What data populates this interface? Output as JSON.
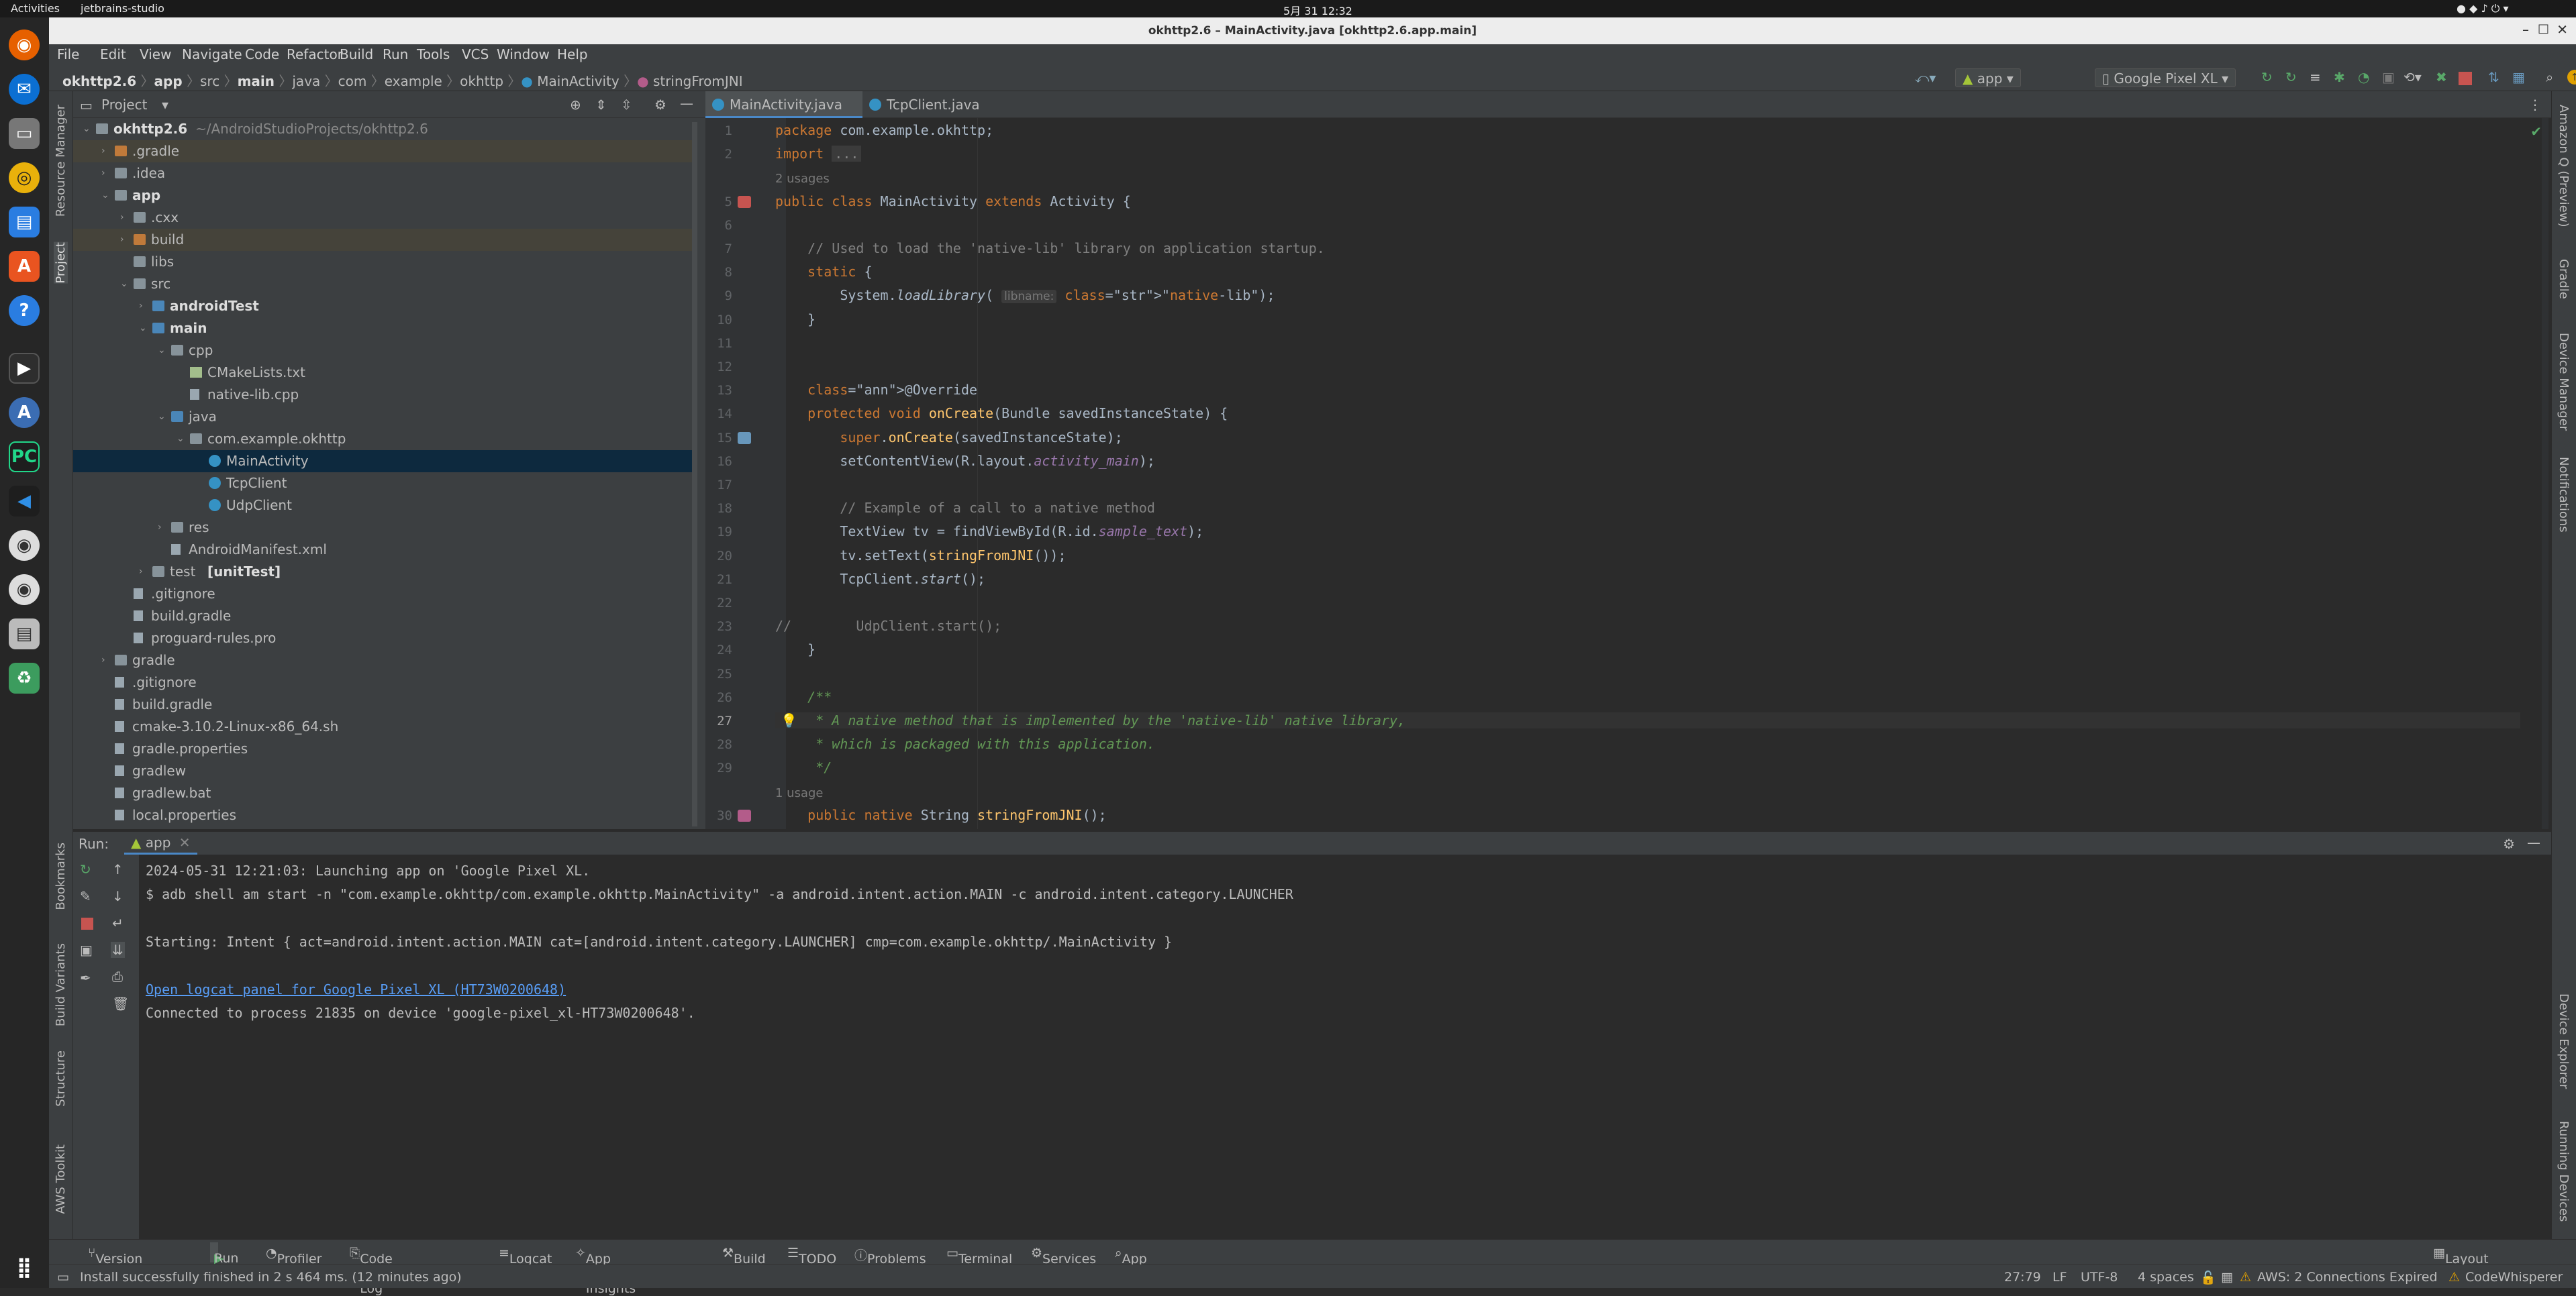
{
  "topbar": {
    "activities": "Activities",
    "app_name": "jetbrains-studio",
    "datetime": "5月 31  12:32"
  },
  "window": {
    "title": "okhttp2.6 – MainActivity.java [okhttp2.6.app.main]"
  },
  "menu": [
    "File",
    "Edit",
    "View",
    "Navigate",
    "Code",
    "Refactor",
    "Build",
    "Run",
    "Tools",
    "VCS",
    "Window",
    "Help"
  ],
  "breadcrumb": [
    "okhttp2.6",
    "app",
    "src",
    "main",
    "java",
    "com",
    "example",
    "okhttp",
    "MainActivity",
    "stringFromJNI"
  ],
  "toolbar": {
    "run_config": "app",
    "device": "Google Pixel XL"
  },
  "left_strip": [
    "Resource Manager",
    "Project",
    "Bookmarks",
    "Build Variants",
    "Structure",
    "AWS Toolkit"
  ],
  "right_strip": [
    "Amazon Q (Preview)",
    "Gradle",
    "Device Manager",
    "Notifications",
    "Device Explorer",
    "Running Devices"
  ],
  "project": {
    "header": "Project",
    "tree": [
      {
        "label": "okhttp2.6",
        "path": "~/AndroidStudioProjects/okhttp2.6",
        "bold": true
      },
      {
        "label": ".gradle"
      },
      {
        "label": ".idea"
      },
      {
        "label": "app",
        "bold": true
      },
      {
        "label": ".cxx"
      },
      {
        "label": "build"
      },
      {
        "label": "libs"
      },
      {
        "label": "src"
      },
      {
        "label": "androidTest",
        "bold": true
      },
      {
        "label": "main",
        "bold": true
      },
      {
        "label": "cpp"
      },
      {
        "label": "CMakeLists.txt"
      },
      {
        "label": "native-lib.cpp"
      },
      {
        "label": "java"
      },
      {
        "label": "com.example.okhttp"
      },
      {
        "label": "MainActivity"
      },
      {
        "label": "TcpClient"
      },
      {
        "label": "UdpClient"
      },
      {
        "label": "res"
      },
      {
        "label": "AndroidManifest.xml"
      },
      {
        "label": "test",
        "suffix": "[unitTest]"
      },
      {
        "label": ".gitignore"
      },
      {
        "label": "build.gradle"
      },
      {
        "label": "proguard-rules.pro"
      },
      {
        "label": "gradle"
      },
      {
        "label": ".gitignore"
      },
      {
        "label": "build.gradle"
      },
      {
        "label": "cmake-3.10.2-Linux-x86_64.sh"
      },
      {
        "label": "gradle.properties"
      },
      {
        "label": "gradlew"
      },
      {
        "label": "gradlew.bat"
      },
      {
        "label": "local.properties"
      }
    ]
  },
  "editor": {
    "tabs": [
      "MainActivity.java",
      "TcpClient.java"
    ],
    "lines": [
      {
        "n": "1",
        "text": "package com.example.okhttp;"
      },
      {
        "n": "2",
        "text": "import ..."
      },
      {
        "hint": "2 usages"
      },
      {
        "n": "5",
        "text": "public class MainActivity extends Activity {"
      },
      {
        "n": "6",
        "text": ""
      },
      {
        "n": "7",
        "text": "    // Used to load the 'native-lib' library on application startup."
      },
      {
        "n": "8",
        "text": "    static {"
      },
      {
        "n": "9",
        "text": "        System.loadLibrary( libname: \"native-lib\");"
      },
      {
        "n": "10",
        "text": "    }"
      },
      {
        "n": "11",
        "text": ""
      },
      {
        "n": "12",
        "text": ""
      },
      {
        "n": "13",
        "text": "    @Override"
      },
      {
        "n": "14",
        "text": "    protected void onCreate(Bundle savedInstanceState) {"
      },
      {
        "n": "15",
        "text": "        super.onCreate(savedInstanceState);"
      },
      {
        "n": "16",
        "text": "        setContentView(R.layout.activity_main);"
      },
      {
        "n": "17",
        "text": ""
      },
      {
        "n": "18",
        "text": "        // Example of a call to a native method"
      },
      {
        "n": "19",
        "text": "        TextView tv = findViewById(R.id.sample_text);"
      },
      {
        "n": "20",
        "text": "        tv.setText(stringFromJNI());"
      },
      {
        "n": "21",
        "text": "        TcpClient.start();"
      },
      {
        "n": "22",
        "text": ""
      },
      {
        "n": "23",
        "text": "//        UdpClient.start();"
      },
      {
        "n": "24",
        "text": "    }"
      },
      {
        "n": "25",
        "text": ""
      },
      {
        "n": "26",
        "text": "    /**"
      },
      {
        "n": "27",
        "text": "     * A native method that is implemented by the 'native-lib' native library,"
      },
      {
        "n": "28",
        "text": "     * which is packaged with this application."
      },
      {
        "n": "29",
        "text": "     */"
      },
      {
        "hint": "1 usage"
      },
      {
        "n": "30",
        "text": "    public native String stringFromJNI();"
      }
    ]
  },
  "run": {
    "label": "Run:",
    "tab": "app",
    "console": [
      "2024-05-31 12:21:03: Launching app on 'Google Pixel XL.",
      "$ adb shell am start -n \"com.example.okhttp/com.example.okhttp.MainActivity\" -a android.intent.action.MAIN -c android.intent.category.LAUNCHER",
      "",
      "Starting: Intent { act=android.intent.action.MAIN cat=[android.intent.category.LAUNCHER] cmp=com.example.okhttp/.MainActivity }",
      "",
      "Open logcat panel for Google Pixel XL (HT73W0200648)",
      "Connected to process 21835 on device 'google-pixel_xl-HT73W0200648'."
    ]
  },
  "bottom_tabs": [
    "Version Control",
    "Run",
    "Profiler",
    "Code Reference Log",
    "Logcat",
    "App Quality Insights",
    "Build",
    "TODO",
    "Problems",
    "Terminal",
    "Services",
    "App Inspection",
    "Layout Inspector"
  ],
  "status": {
    "message": "Install successfully finished in 2 s 464 ms. (12 minutes ago)",
    "position": "27:79",
    "line_sep": "LF",
    "encoding": "UTF-8",
    "indent": "4 spaces",
    "aws": "AWS: 2 Connections Expired",
    "codewhisperer": "CodeWhisperer"
  },
  "colors": {
    "accent": "#4a88c7",
    "selection": "#0d293e",
    "keyword": "#cc7832",
    "string": "#6a8759",
    "comment": "#808080"
  }
}
